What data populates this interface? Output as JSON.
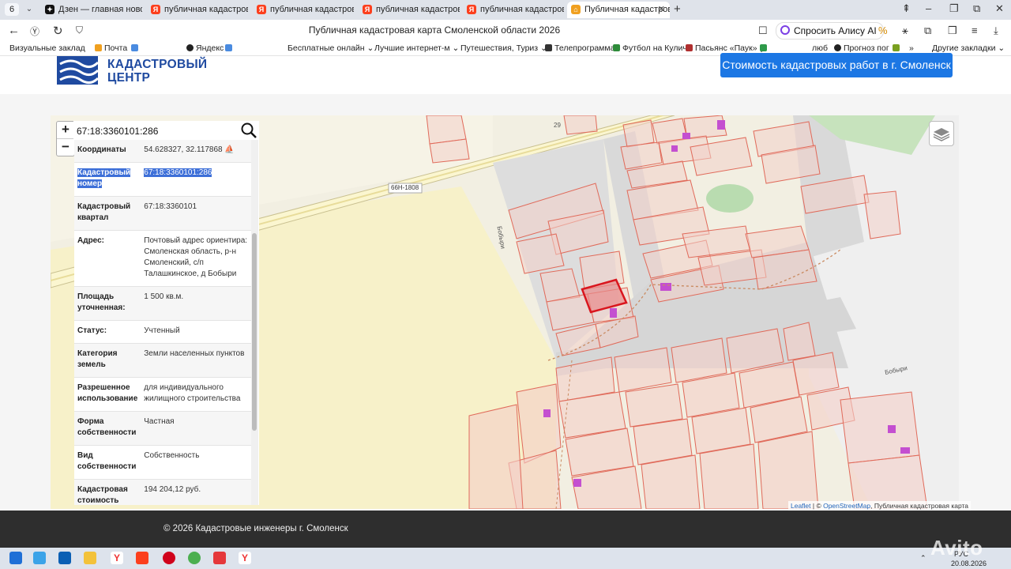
{
  "browser": {
    "tab_count": "6",
    "tabs": [
      {
        "label": "Дзен — главная новостн",
        "icon": "dzen-icon",
        "color": "#111111"
      },
      {
        "label": "публичная кадастровая к",
        "icon": "yandex-icon",
        "color": "#fc3f1d"
      },
      {
        "label": "публичная кадастровая к",
        "icon": "yandex-icon",
        "color": "#fc3f1d"
      },
      {
        "label": "публичная кадастровая к",
        "icon": "yandex-icon",
        "color": "#fc3f1d"
      },
      {
        "label": "публичная кадастровая к",
        "icon": "yandex-icon",
        "color": "#fc3f1d"
      },
      {
        "label": "Публичная кадастрова",
        "icon": "site-icon",
        "color": "#f0a020"
      }
    ],
    "page_title": "Публичная кадастровая карта Смоленской области 2026",
    "alice_label": "Спросить Алису AI",
    "bookmarks": [
      "Визуальные заклад",
      "Почта",
      "Яндекс",
      "Бесплатные онлайн",
      "Лучшие интернет-м",
      "Путешествия, Туриз",
      "Телепрограмма",
      "Футбол на Кулич",
      "Пасьянс «Паук» (",
      "люб",
      "Прогноз пог",
      "»",
      "Другие закладки"
    ]
  },
  "site": {
    "logo_line1": "КАДАСТРОВЫЙ",
    "logo_line2": "ЦЕНТР",
    "cta_button": "Стоимость кадастровых работ в г. Смоленск",
    "footer_text": "© 2026 Кадастровые инженеры г. Смоленск"
  },
  "map": {
    "search_value": "67:18:3360101:286",
    "zoom_in": "+",
    "zoom_out": "−",
    "road_label": "66Н-1808",
    "street_label_1": "Бобыри",
    "street_label_2": "Бобыри",
    "plot_label": "29",
    "attribution_leaflet": "Leaflet",
    "attribution_sep": " | © ",
    "attribution_osm": "OpenStreetMap",
    "attribution_rest": ", Публичная кадастровая карта"
  },
  "parcel_info": [
    {
      "key": "Координаты",
      "value": "54.628327, 32.117868"
    },
    {
      "key": "Кадастровый номер",
      "value": "67:18:3360101:286"
    },
    {
      "key": "Кадастровый квартал",
      "value": "67:18:3360101"
    },
    {
      "key": "Адрес:",
      "value": "Почтовый адрес ориентира: Смоленская область, р-н Смоленский, с/п Талашкинское, д Бобыри"
    },
    {
      "key": "Площадь уточненная:",
      "value": "1 500 кв.м."
    },
    {
      "key": "Статус:",
      "value": "Учтенный"
    },
    {
      "key": "Категория земель",
      "value": "Земли населенных пунктов"
    },
    {
      "key": "Разрешенное использование",
      "value": "для индивидуального жилищного строительства"
    },
    {
      "key": "Форма собственности",
      "value": "Частная"
    },
    {
      "key": "Вид собственности",
      "value": "Собственность"
    },
    {
      "key": "Кадастровая стоимость",
      "value": "194 204,12 руб."
    }
  ],
  "taskbar": {
    "lang": "РУС",
    "date": "20.08.2026"
  },
  "watermark": "Avito",
  "colors": {
    "accent": "#1c77e4",
    "logo": "#1f4aa0",
    "parcel_fill": "#f3cfc8",
    "parcel_stroke": "#e06a5a",
    "selected_parcel": "#d9161e",
    "building": "#c44fd0",
    "road": "#e6e2d2"
  }
}
